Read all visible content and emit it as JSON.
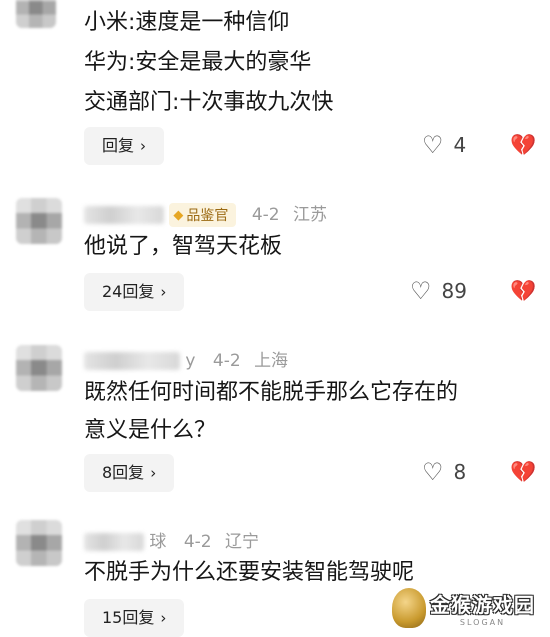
{
  "comments": [
    {
      "lines": [
        "小米:速度是一种信仰",
        "华为:安全是最大的豪华",
        "交通部门:十次事故九次快"
      ],
      "reply_label": "回复",
      "likes": "4"
    },
    {
      "badge": "品鉴官",
      "date": "4-2",
      "location": "江苏",
      "text": "他说了，智驾天花板",
      "reply_label": "24回复",
      "likes": "89"
    },
    {
      "name_tail": "y",
      "date": "4-2",
      "location": "上海",
      "lines": [
        "既然任何时间都不能脱手那么它存在的",
        "意义是什么？"
      ],
      "reply_label": "8回复",
      "likes": "8"
    },
    {
      "name_tail": "球",
      "date": "4-2",
      "location": "辽宁",
      "text": "不脱手为什么还要安装智能驾驶呢",
      "reply_label": "15回复"
    }
  ],
  "watermark": {
    "text": "金猴游戏园",
    "sub": "SLOGAN"
  },
  "icons": {
    "like": "heart-outline-icon",
    "dislike": "broken-heart-icon",
    "chevron": "chevron-right-icon"
  }
}
